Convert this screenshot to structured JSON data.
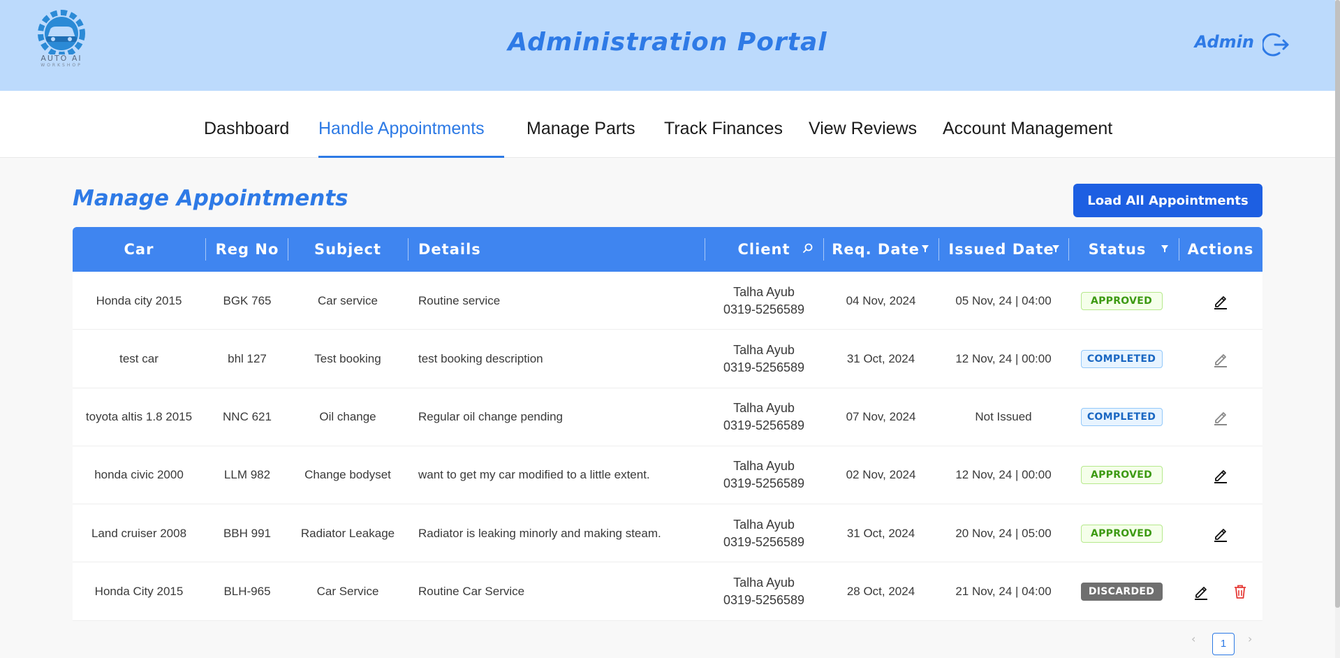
{
  "header": {
    "logo_text": "AUTO AI",
    "logo_sub": "WORKSHOP",
    "title": "Administration Portal",
    "user": "Admin"
  },
  "nav": {
    "items": [
      {
        "label": "Dashboard",
        "active": false
      },
      {
        "label": "Handle Appointments",
        "active": true
      },
      {
        "label": "Manage Parts",
        "active": false
      },
      {
        "label": "Track Finances",
        "active": false
      },
      {
        "label": "View Reviews",
        "active": false
      },
      {
        "label": "Account Management",
        "active": false
      }
    ]
  },
  "page": {
    "title": "Manage Appointments",
    "load_button": "Load All Appointments"
  },
  "table": {
    "columns": [
      "Car",
      "Reg No",
      "Subject",
      "Details",
      "Client",
      "Req. Date",
      "Issued Date",
      "Status",
      "Actions"
    ],
    "rows": [
      {
        "car": "Honda city 2015",
        "reg": "BGK 765",
        "subject": "Car service",
        "details": "Routine service",
        "client_name": "Talha Ayub",
        "client_phone": "0319-5256589",
        "req_date": "04 Nov, 2024",
        "issued": "05 Nov, 24 | 04:00",
        "status": "APPROVED"
      },
      {
        "car": "test car",
        "reg": "bhl 127",
        "subject": "Test booking",
        "details": "test booking description",
        "client_name": "Talha Ayub",
        "client_phone": "0319-5256589",
        "req_date": "31 Oct, 2024",
        "issued": "12 Nov, 24 | 00:00",
        "status": "COMPLETED"
      },
      {
        "car": "toyota altis 1.8 2015",
        "reg": "NNC 621",
        "subject": "Oil change",
        "details": "Regular oil change pending",
        "client_name": "Talha Ayub",
        "client_phone": "0319-5256589",
        "req_date": "07 Nov, 2024",
        "issued": "Not Issued",
        "status": "COMPLETED"
      },
      {
        "car": "honda civic 2000",
        "reg": "LLM 982",
        "subject": "Change bodyset",
        "details": "want to get my car modified to a little extent.",
        "client_name": "Talha Ayub",
        "client_phone": "0319-5256589",
        "req_date": "02 Nov, 2024",
        "issued": "12 Nov, 24 | 00:00",
        "status": "APPROVED"
      },
      {
        "car": "Land cruiser 2008",
        "reg": "BBH 991",
        "subject": "Radiator Leakage",
        "details": "Radiator is leaking minorly and making steam.",
        "client_name": "Talha Ayub",
        "client_phone": "0319-5256589",
        "req_date": "31 Oct, 2024",
        "issued": "20 Nov, 24 | 05:00",
        "status": "APPROVED"
      },
      {
        "car": "Honda City 2015",
        "reg": "BLH-965",
        "subject": "Car Service",
        "details": "Routine Car Service",
        "client_name": "Talha Ayub",
        "client_phone": "0319-5256589",
        "req_date": "28 Oct, 2024",
        "issued": "21 Nov, 24 | 04:00",
        "status": "DISCARDED"
      }
    ]
  },
  "pagination": {
    "current": "1",
    "prev": "‹",
    "next": "›"
  },
  "icons": {
    "logo": "car-gear-logo-icon",
    "logout": "logout-icon",
    "search": "search-icon",
    "filter": "filter-icon",
    "edit": "edit-icon",
    "delete": "trash-icon"
  },
  "colors": {
    "header_bg": "#bcdafc",
    "accent": "#2e7ae6",
    "table_header": "#3f85f0",
    "button": "#1d5fe2",
    "delete": "#e53935"
  }
}
